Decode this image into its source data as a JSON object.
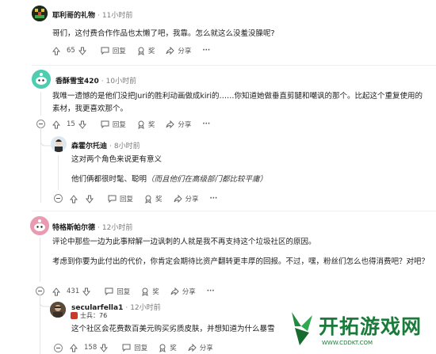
{
  "comments": [
    {
      "user": "耶利哥的礼物",
      "time": "11小时前",
      "text": "哥们，这付费合作作品也太懒了吧，我靠。怎么就这么没羞没臊呢?",
      "votes": "65",
      "reply": "回复",
      "award": "奖",
      "share": "分享",
      "more": "···"
    },
    {
      "user": "香酥雪宝420",
      "time": "10小时前",
      "text": "我唯一遗憾的是他们没把Juri的胜利动画做成kiri的……你知道她做垂直剪腿和嘲讽的那个。比起这个重复使用的素材，我更喜欢那个。",
      "votes": "15",
      "reply": "回复",
      "award": "奖",
      "share": "分享",
      "more": "···"
    },
    {
      "user": "森霍尔托迪",
      "time": "8小时前",
      "text1": "这对两个角色来说更有意义",
      "text2": "他们俩都很时髦、聪明",
      "text2_italic": "（而且他们在高级部门都比较平庸）",
      "votes": "",
      "reply": "回复",
      "award": "奖",
      "share": "分享",
      "more": "···"
    },
    {
      "user": "特格斯帕尔德",
      "time": "12小时前",
      "text1": "评论中那些一边为此事辩解一边讽刺的人就是我不再支持这个垃圾社区的原因。",
      "text2": "考虑到你要为此付出的代价，你肯定会期待比资产翻转更丰厚的回报。不过，嘿，粉丝们怎么也得消费吧？对吧？",
      "votes": "431",
      "reply": "回复",
      "award": "奖",
      "share": "分享",
      "more": "···"
    },
    {
      "user": "secularfella1",
      "time": "12小时前",
      "flair": "士兵：76",
      "text": "这个社区会花费数百美元购买劣质皮肤，并想知道为什么暴雪",
      "votes": "158",
      "reply": "回复",
      "award": "奖",
      "share": "分享"
    }
  ],
  "watermark": {
    "title": "开拓游戏网",
    "url": "WWW.CDDKT.COM"
  }
}
